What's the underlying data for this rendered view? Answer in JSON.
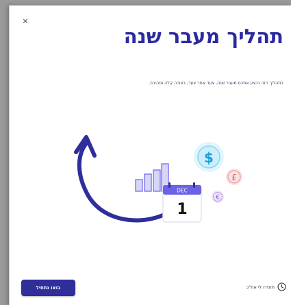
{
  "dialog": {
    "close_label": "×",
    "title": "תהליך מעבר שנה",
    "subtitle": "בתהליך הזה נבצע אתכם מעבר שנה, צעד אחר צעד, בצורה קלה ומהירה."
  },
  "illustration": {
    "calendar_month": "DEC",
    "calendar_day": "1",
    "coin_dollar": "$",
    "coin_pound": "£",
    "coin_euro": "€"
  },
  "footer": {
    "start_button_label": "בואו נתחיל",
    "remind_later_label": "תזכירו לי אח\"כ"
  },
  "colors": {
    "accent": "#2f2e9b",
    "title": "#2b2a9e",
    "calendar": "#6b62e6",
    "dollar_coin": "#cdeefc",
    "pound_coin": "#f9d6d6",
    "euro_coin": "#e7d9f7",
    "bars": "#d8d6f7"
  }
}
